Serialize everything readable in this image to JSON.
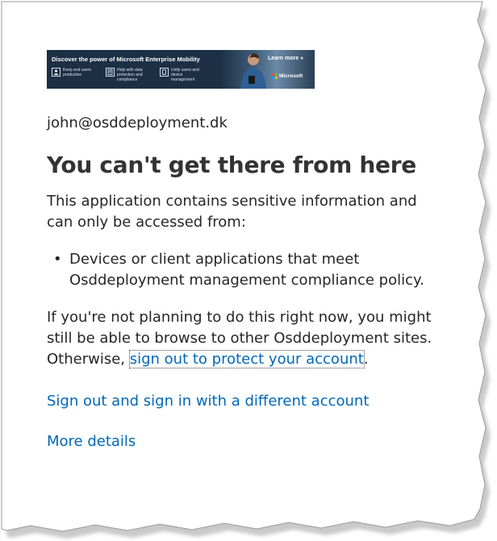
{
  "banner": {
    "title": "Discover the power of Microsoft Enterprise Mobility",
    "learn_more": "Learn more »",
    "brand": "Microsoft",
    "features": [
      {
        "icon": "user-icon",
        "text": "Keep end users productive"
      },
      {
        "icon": "document-icon",
        "text": "Help with data protection and compliance"
      },
      {
        "icon": "device-icon",
        "text": "Unify users and device management"
      }
    ],
    "colors": {
      "background": "#1c2f44",
      "ms_red": "#f25022",
      "ms_green": "#7fba00",
      "ms_blue": "#00a4ef",
      "ms_yellow": "#ffb900"
    }
  },
  "account": {
    "email": "john@osddeployment.dk"
  },
  "main": {
    "heading": "You can't get there from here",
    "intro": "This application contains sensitive information and can only be accessed from:",
    "bullets": [
      "Devices or client applications that meet Osddeployment management compliance policy."
    ],
    "advice_prefix": "If you're not planning to do this right now, you might still be able to browse to other Osddeployment sites. Otherwise, ",
    "advice_link": "sign out to protect your account",
    "advice_suffix": "."
  },
  "links": {
    "switch_account": "Sign out and sign in with a different account",
    "more_details": "More details"
  },
  "colors": {
    "link": "#0067b8",
    "text": "#262626",
    "heading": "#333333"
  }
}
